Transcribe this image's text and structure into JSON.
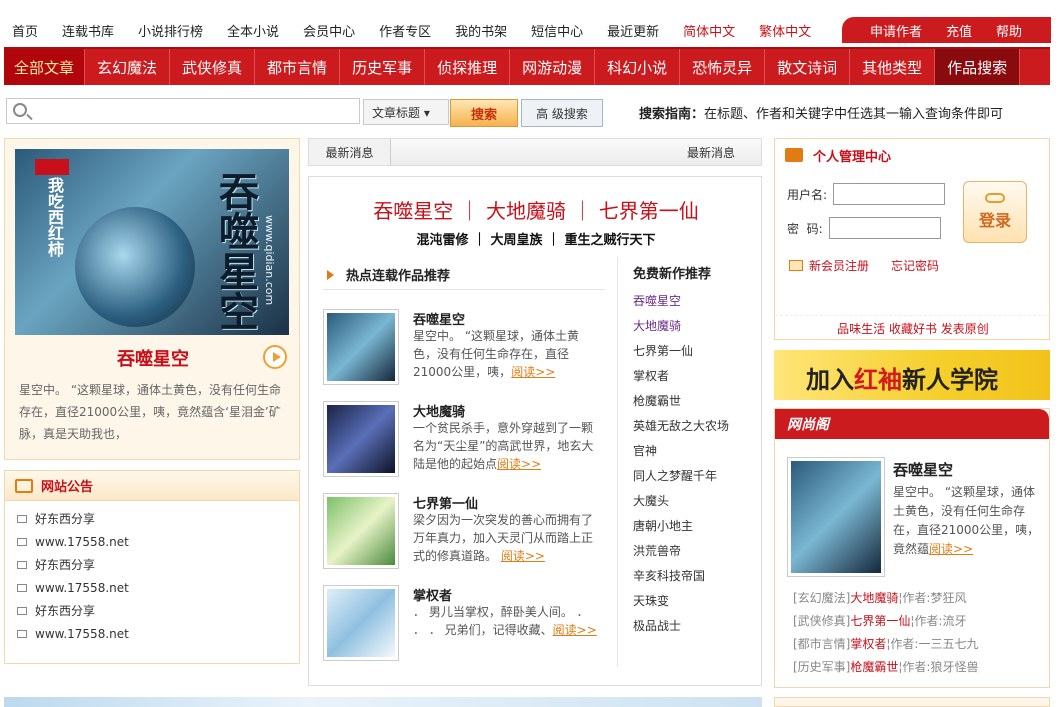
{
  "top_nav": {
    "items": [
      "首页",
      "连载书库",
      "小说排行榜",
      "全本小说",
      "会员中心",
      "作者专区",
      "我的书架",
      "短信中心",
      "最近更新"
    ],
    "red_items": [
      "简体中文",
      "繁体中文"
    ],
    "right_items": [
      "申请作者",
      "充值",
      "帮助"
    ]
  },
  "main_nav": {
    "active": "全部文章",
    "items": [
      "玄幻魔法",
      "武侠修真",
      "都市言情",
      "历史军事",
      "侦探推理",
      "网游动漫",
      "科幻小说",
      "恐怖灵异",
      "散文诗词",
      "其他类型"
    ],
    "last": "作品搜索"
  },
  "search": {
    "value": "",
    "select_label": "文章标题 ▾",
    "button_label": "搜索",
    "advanced_label": "高 级搜索",
    "guide_label": "搜索指南：",
    "guide_text": "在标题、作者和关键字中任选其一输入查询条件即可"
  },
  "featured": {
    "cover_title": "吞噬星空",
    "cover_sub": "我吃西红柿",
    "cover_url": "www.qidian.com",
    "title": "吞噬星空",
    "desc": "星空中。 “这颗星球，通体土黄色，没有任何生命存在，直径21000公里，咦，竟然蕴含‘星泪金’矿脉，真是天助我也，"
  },
  "notice": {
    "title": "网站公告",
    "items": [
      "好东西分享",
      "www.17558.net",
      "好东西分享",
      "www.17558.net",
      "好东西分享",
      "www.17558.net"
    ]
  },
  "news_header": {
    "tab_left": "最新消息",
    "tab_right": "最新消息"
  },
  "hot_titles": {
    "line1": "吞噬星空 ｜ 大地魔骑 ｜ 七界第一仙",
    "line2": "混沌雷修 ｜ 大周皇族 ｜ 重生之贼行天下"
  },
  "hot_section": {
    "title": "热点连载作品推荐",
    "books": [
      {
        "title": "吞噬星空",
        "desc": "星空中。 “这颗星球，通体土黄色，没有任何生命存在，直径21000公里，咦，",
        "more": "阅读>>"
      },
      {
        "title": "大地魔骑",
        "desc": "一个贫民杀手，意外穿越到了一颗名为“天尘星”的高武世界，地玄大陆是他的起始点",
        "more": "阅读>>"
      },
      {
        "title": "七界第一仙",
        "desc": "梁夕因为一次突发的善心而拥有了万年真力，加入天灵门从而踏上正式的修真道路。 ",
        "more": "阅读>>"
      },
      {
        "title": "掌权者",
        "desc": "． 男儿当掌权，醉卧美人间。 ． ． ． 兄弟们，记得收藏、",
        "more": "阅读>>"
      }
    ]
  },
  "free_section": {
    "title": "免费新作推荐",
    "items": [
      "吞噬星空",
      "大地魔骑",
      "七界第一仙",
      "掌权者",
      "枪魔霸世",
      "英雄无敌之大农场",
      "官神",
      "同人之梦醒千年",
      "大魔头",
      "唐朝小地主",
      "洪荒兽帝",
      "辛亥科技帝国",
      "天珠变",
      "极品战士"
    ]
  },
  "login": {
    "title": "个人管理中心",
    "username_label": "用户名:",
    "password_label": "密  码:",
    "button_label": "登录",
    "register_label": "新会员注册",
    "forgot_label": "忘记密码",
    "footer": "品味生活 收藏好书 发表原创"
  },
  "banner": {
    "part1": "加入",
    "part2": "红袖",
    "part3": "新人学院"
  },
  "shop": {
    "title": "网尚阁",
    "book_title": "吞噬星空",
    "book_desc": "星空中。 “这颗星球，通体土黄色，没有任何生命存在，直径21000公里，咦，竟然蕴",
    "more": "阅读>>",
    "list": [
      {
        "cat": "[玄幻魔法]",
        "title": "大地魔骑",
        "sep": "¦作者:",
        "author": "梦狂风"
      },
      {
        "cat": "[武侠修真]",
        "title": "七界第一仙",
        "sep": "¦作者:",
        "author": "流牙"
      },
      {
        "cat": "[都市言情]",
        "title": "掌权者",
        "sep": "¦作者:",
        "author": "一三五七九"
      },
      {
        "cat": "[历史军事]",
        "title": "枪魔霸世",
        "sep": "¦作者:",
        "author": "狼牙怪兽"
      }
    ]
  },
  "colors": {
    "brand_red": "#cc1b1f",
    "accent_orange": "#e07c13",
    "panel_bg": "#fdf6e9"
  }
}
